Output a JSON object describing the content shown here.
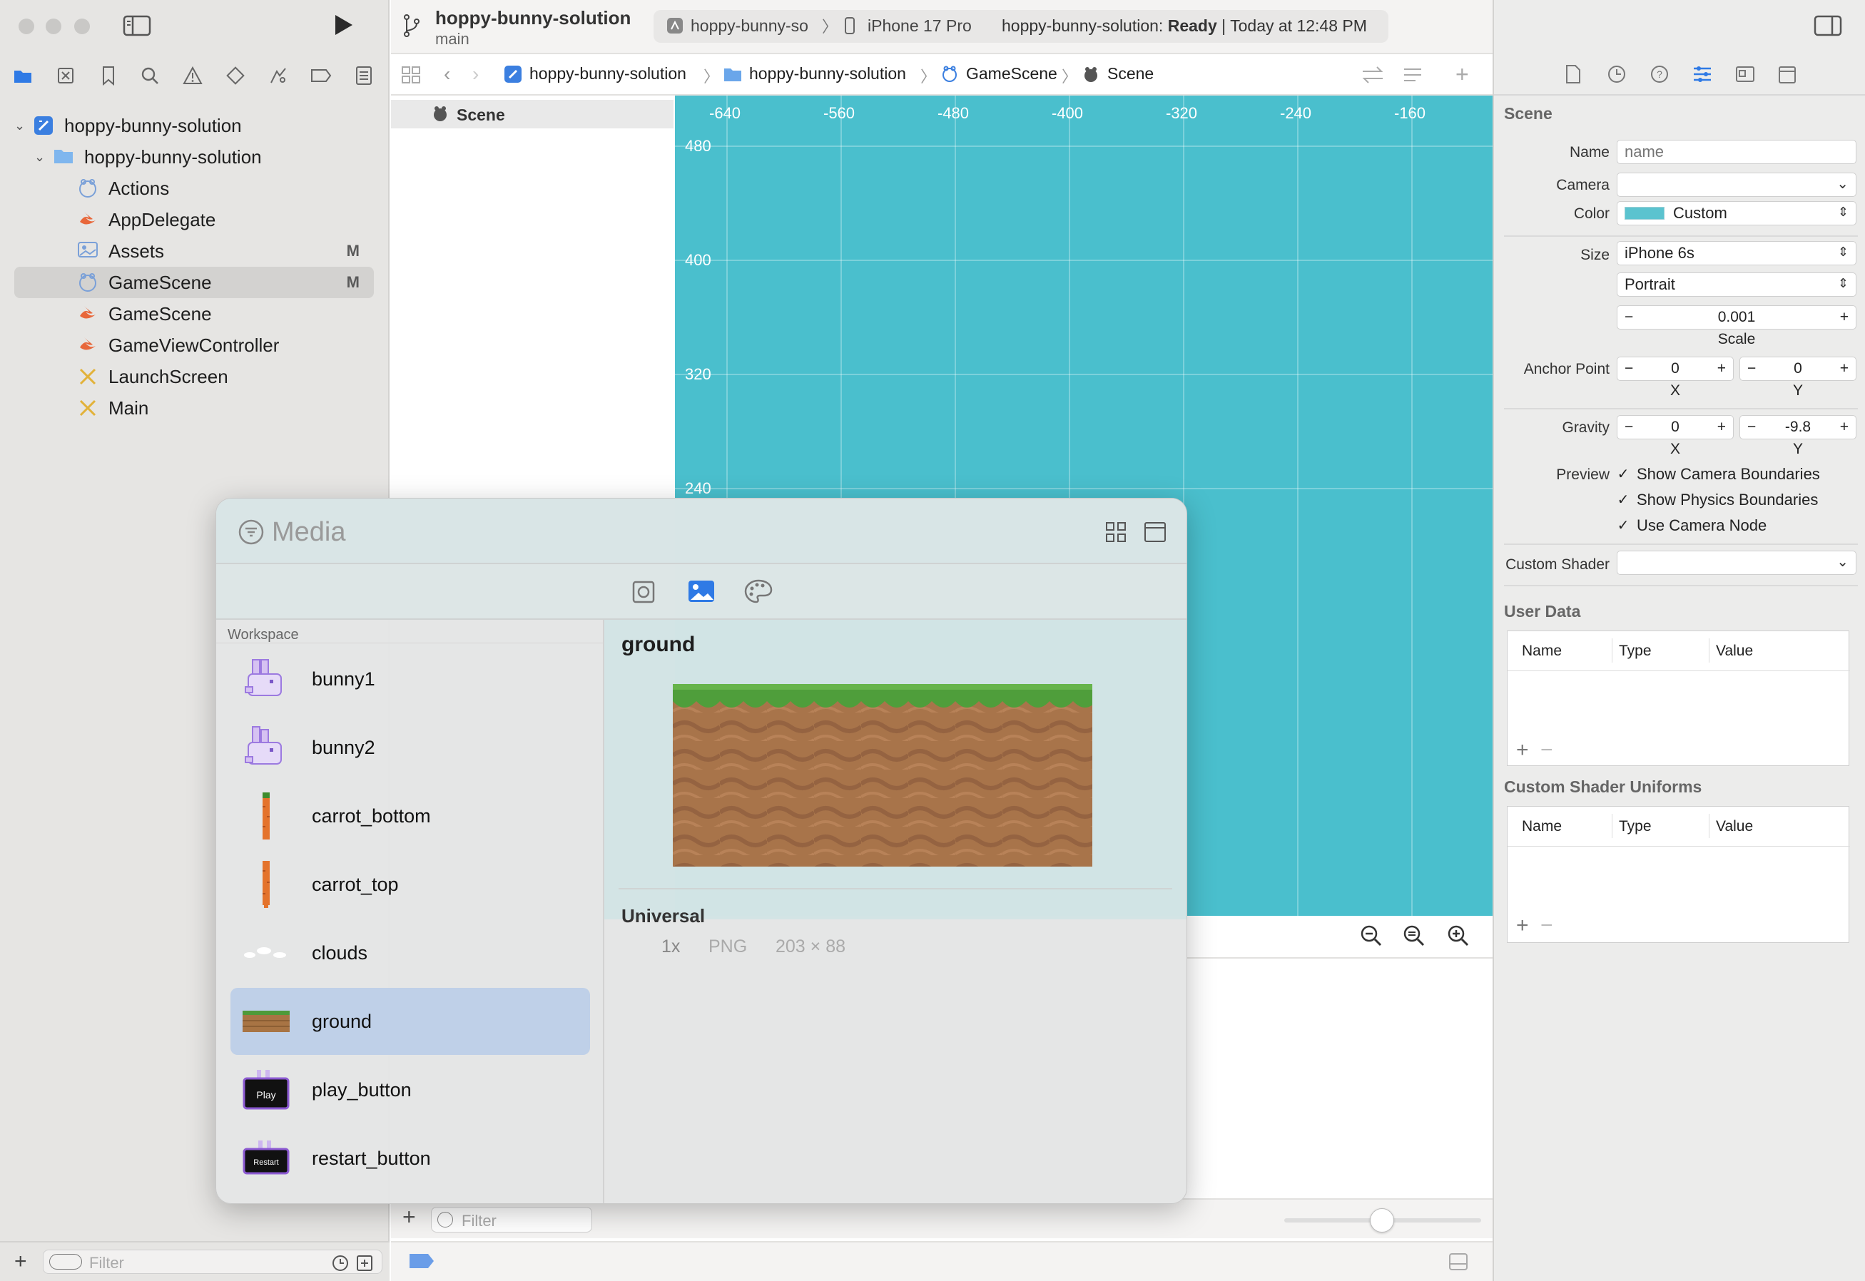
{
  "window": {
    "project_title": "hoppy-bunny-solution",
    "branch": "main",
    "scheme": "hoppy-bunny-so",
    "device": "iPhone 17 Pro",
    "status_prefix": "hoppy-bunny-solution:",
    "status_state": "Ready",
    "status_time": "Today at 12:48 PM"
  },
  "navigator": {
    "items": [
      {
        "label": "hoppy-bunny-solution",
        "badge": ""
      },
      {
        "label": "hoppy-bunny-solution",
        "badge": ""
      },
      {
        "label": "Actions",
        "badge": ""
      },
      {
        "label": "AppDelegate",
        "badge": ""
      },
      {
        "label": "Assets",
        "badge": "M"
      },
      {
        "label": "GameScene",
        "badge": "M"
      },
      {
        "label": "GameScene",
        "badge": ""
      },
      {
        "label": "GameViewController",
        "badge": ""
      },
      {
        "label": "LaunchScreen",
        "badge": ""
      },
      {
        "label": "Main",
        "badge": ""
      }
    ],
    "filter_placeholder": "Filter"
  },
  "jumpbar": {
    "crumbs": [
      "hoppy-bunny-solution",
      "hoppy-bunny-solution",
      "GameScene",
      "Scene"
    ]
  },
  "outline": {
    "root": "Scene"
  },
  "scene_editor": {
    "x_ticks": [
      "-640",
      "-560",
      "-480",
      "-400",
      "-320",
      "-240",
      "-160"
    ],
    "y_ticks": [
      "480",
      "400",
      "320",
      "240"
    ],
    "background": "#4abfcd",
    "filter_placeholder": "Filter"
  },
  "inspector": {
    "section_title": "Scene",
    "name_label": "Name",
    "name_placeholder": "name",
    "camera_label": "Camera",
    "color_label": "Color",
    "color_value": "Custom",
    "color_swatch": "#5bc3cf",
    "size_label": "Size",
    "size_value": "iPhone 6s",
    "orientation_value": "Portrait",
    "scale_value": "0.001",
    "scale_label": "Scale",
    "anchor_label": "Anchor Point",
    "anchor_x": "0",
    "anchor_y": "0",
    "gravity_label": "Gravity",
    "gravity_x": "0",
    "gravity_y": "-9.8",
    "x_label": "X",
    "y_label": "Y",
    "preview_label": "Preview",
    "checks": [
      "Show Camera Boundaries",
      "Show Physics Boundaries",
      "Use Camera Node"
    ],
    "custom_shader_label": "Custom Shader",
    "user_data_title": "User Data",
    "uniforms_title": "Custom Shader Uniforms",
    "columns": [
      "Name",
      "Type",
      "Value"
    ]
  },
  "media": {
    "title": "Media",
    "group": "Workspace",
    "items": [
      "bunny1",
      "bunny2",
      "carrot_bottom",
      "carrot_top",
      "clouds",
      "ground",
      "play_button",
      "restart_button"
    ],
    "selected_name": "ground",
    "variant_title": "Universal",
    "scale": "1x",
    "format": "PNG",
    "dimensions": "203 × 88",
    "play_text": "Play",
    "restart_text": "Restart"
  }
}
